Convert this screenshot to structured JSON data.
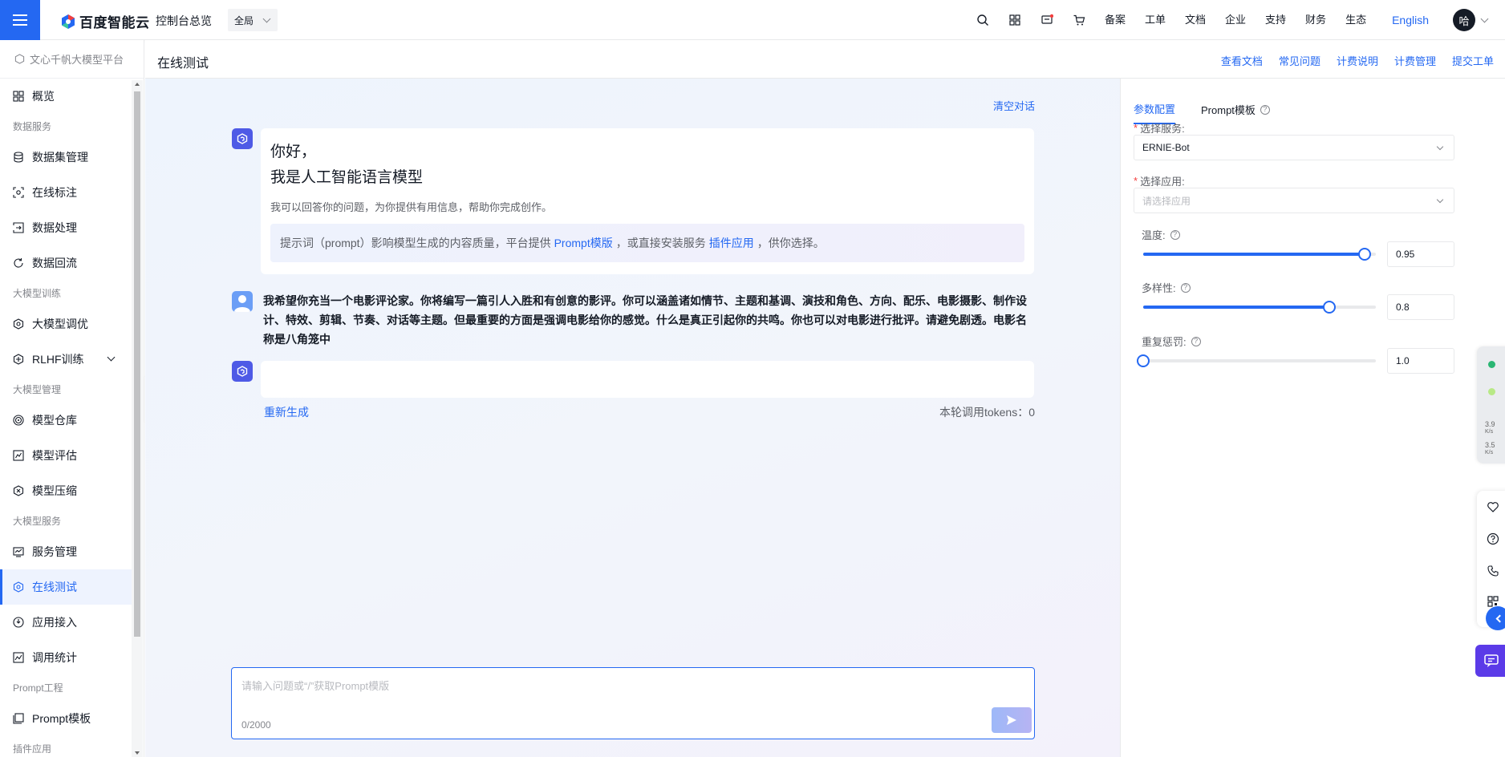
{
  "topbar": {
    "brand": "百度智能云",
    "console": "控制台总览",
    "region": "全局",
    "links": [
      "备案",
      "工单",
      "文档",
      "企业",
      "支持",
      "财务",
      "生态"
    ],
    "language": "English",
    "avatar_initial": "哈"
  },
  "sidebar": {
    "platform": "文心千帆大模型平台",
    "overview": "概览",
    "groups": {
      "data": "数据服务",
      "train": "大模型训练",
      "manage": "大模型管理",
      "service": "大模型服务",
      "prompt": "Prompt工程",
      "plugin": "插件应用"
    },
    "items": {
      "dataset": "数据集管理",
      "annotate": "在线标注",
      "process": "数据处理",
      "reflux": "数据回流",
      "finetune": "大模型调优",
      "rlhf": "RLHF训练",
      "repo": "模型仓库",
      "eval": "模型评估",
      "compress": "模型压缩",
      "svc_manage": "服务管理",
      "online_test": "在线测试",
      "app_access": "应用接入",
      "stats": "调用统计",
      "prompt_tpl": "Prompt模板"
    }
  },
  "page": {
    "title": "在线测试",
    "links": [
      "查看文档",
      "常见问题",
      "计费说明",
      "计费管理",
      "提交工单"
    ]
  },
  "chat": {
    "clear": "清空对话",
    "greeting_line1": "你好，",
    "greeting_line2": "我是人工智能语言模型",
    "greeting_sub": "我可以回答你的问题，为你提供有用信息，帮助你完成创作。",
    "tip_prefix": "提示词（prompt）影响模型生成的内容质量，平台提供",
    "tip_link1": "Prompt模版",
    "tip_mid": "，或直接安装服务",
    "tip_link2": "插件应用",
    "tip_suffix": "，供你选择。",
    "user_message": "我希望你充当一个电影评论家。你将编写一篇引人入胜和有创意的影评。你可以涵盖诸如情节、主题和基调、演技和角色、方向、配乐、电影摄影、制作设计、特效、剪辑、节奏、对话等主题。但最重要的方面是强调电影给你的感觉。什么是真正引起你的共鸣。你也可以对电影进行批评。请避免剧透。电影名称是八角笼中",
    "regenerate": "重新生成",
    "tokens": "本轮调用tokens：0",
    "input_placeholder": "请输入问题或“/”获取Prompt模版",
    "char_count": "0/2000"
  },
  "panel": {
    "tab_params": "参数配置",
    "tab_prompt": "Prompt模板",
    "service_label": "选择服务:",
    "service_value": "ERNIE-Bot",
    "app_label": "选择应用:",
    "app_placeholder": "请选择应用",
    "temperature_label": "温度:",
    "temperature_value": "0.95",
    "temperature_level": 0.95,
    "diversity_label": "多样性:",
    "diversity_value": "0.8",
    "diversity_level": 0.8,
    "penalty_label": "重复惩罚:",
    "penalty_value": "1.0",
    "penalty_level": 0.0
  },
  "widgets": {
    "upload_speed": "3.9",
    "upload_unit": "K/s",
    "download_speed": "3.5",
    "download_unit": "K/s"
  },
  "colors": {
    "accent": "#2468f2",
    "bot_avatar": "#4e5ae6",
    "send_gradient_start": "#9db8f8"
  }
}
